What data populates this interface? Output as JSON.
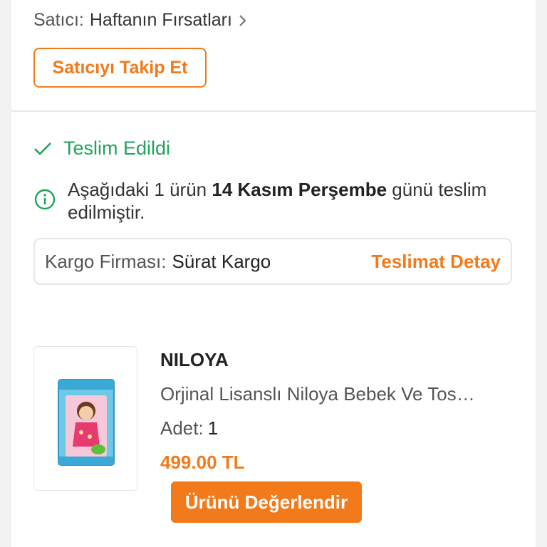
{
  "seller": {
    "label": "Satıcı:",
    "name": "Haftanın Fırsatları",
    "follow_label": "Satıcıyı Takip Et"
  },
  "delivery": {
    "status": "Teslim Edildi",
    "info_pre": "Aşağıdaki 1 ürün ",
    "info_date": "14 Kasım Perşembe",
    "info_post": " günü teslim edilmiştir.",
    "cargo_label": "Kargo Firması:",
    "cargo_name": "Sürat Kargo",
    "detail_link": "Teslimat Detay"
  },
  "product": {
    "brand": "NILOYA",
    "name": "Orjinal Lisanslı Niloya Bebek Ve Tos…",
    "qty_label": "Adet:",
    "qty_value": "1",
    "price": "499.00 TL",
    "rate_label": "Ürünü Değerlendir"
  },
  "colors": {
    "accent": "#f27a1a",
    "success": "#1fa35c"
  },
  "icons": [
    "chevron-right-icon",
    "check-icon",
    "info-icon"
  ]
}
